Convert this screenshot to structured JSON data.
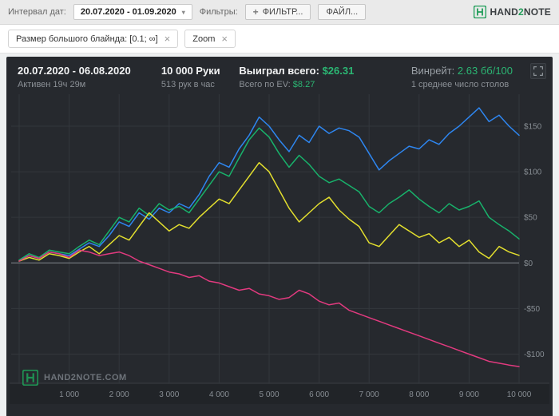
{
  "topbar": {
    "date_interval_label": "Интервал дат:",
    "date_range_value": "20.07.2020 - 01.09.2020",
    "filters_label": "Фильтры:",
    "filter_button": "ФИЛЬТР...",
    "file_button": "ФАЙЛ...",
    "brand_hand": "HAND",
    "brand_2": "2",
    "brand_note": "NOTE"
  },
  "icons": {
    "close": "×",
    "caret": "▾",
    "plus": "+"
  },
  "chips": [
    {
      "label": "Размер большого блайнда: [0.1; ∞]"
    },
    {
      "label": "Zoom"
    }
  ],
  "stats": {
    "date_range": "20.07.2020 - 06.08.2020",
    "active_time": "Активен 19ч 29м",
    "hands": "10 000 Руки",
    "hands_per_hour": "513 рук в час",
    "won_label": "Выиграл всего:",
    "won_value": "$26.31",
    "ev_label": "Всего по EV:",
    "ev_value": "$8.27",
    "winrate_label": "Винрейт:",
    "winrate_value": "2.63 бб/100",
    "tables_avg": "1 среднее число столов"
  },
  "watermark": "HAND2NOTE.COM",
  "chart_data": {
    "type": "line",
    "xlabel": "hands",
    "ylabel": "$ won",
    "xlim": [
      0,
      10000
    ],
    "ylim": [
      -132,
      178
    ],
    "x_step": 200,
    "grid": true,
    "x_ticks": [
      {
        "v": 1000,
        "label": "1 000"
      },
      {
        "v": 2000,
        "label": "2 000"
      },
      {
        "v": 3000,
        "label": "3 000"
      },
      {
        "v": 4000,
        "label": "4 000"
      },
      {
        "v": 5000,
        "label": "5 000"
      },
      {
        "v": 6000,
        "label": "6 000"
      },
      {
        "v": 7000,
        "label": "7 000"
      },
      {
        "v": 8000,
        "label": "8 000"
      },
      {
        "v": 9000,
        "label": "9 000"
      },
      {
        "v": 10000,
        "label": "10 000"
      }
    ],
    "y_ticks": [
      {
        "v": 150,
        "label": "$150"
      },
      {
        "v": 100,
        "label": "$100"
      },
      {
        "v": 50,
        "label": "$50"
      },
      {
        "v": 0,
        "label": "$0"
      },
      {
        "v": -50,
        "label": "-$50"
      },
      {
        "v": -100,
        "label": "-$100"
      }
    ],
    "series": [
      {
        "name": "blue-line",
        "color": "#2e86f0",
        "values": [
          3,
          8,
          5,
          12,
          10,
          8,
          15,
          22,
          18,
          30,
          45,
          40,
          55,
          48,
          60,
          55,
          65,
          60,
          75,
          95,
          110,
          105,
          125,
          140,
          160,
          150,
          135,
          122,
          140,
          132,
          150,
          142,
          148,
          145,
          138,
          120,
          102,
          112,
          120,
          128,
          125,
          135,
          130,
          142,
          150,
          160,
          170,
          155,
          162,
          150,
          140
        ]
      },
      {
        "name": "green-line",
        "color": "#18b26b",
        "values": [
          3,
          10,
          6,
          14,
          12,
          10,
          18,
          25,
          20,
          35,
          50,
          45,
          60,
          52,
          65,
          58,
          62,
          55,
          70,
          85,
          100,
          95,
          115,
          135,
          148,
          138,
          120,
          105,
          118,
          108,
          95,
          88,
          92,
          85,
          78,
          62,
          55,
          65,
          72,
          80,
          70,
          62,
          55,
          65,
          58,
          62,
          68,
          50,
          42,
          35,
          26.31
        ]
      },
      {
        "name": "yellow-line",
        "color": "#e3df2e",
        "values": [
          2,
          6,
          3,
          10,
          8,
          5,
          12,
          18,
          10,
          20,
          30,
          25,
          40,
          55,
          45,
          35,
          42,
          38,
          50,
          60,
          70,
          65,
          80,
          95,
          110,
          100,
          80,
          60,
          45,
          55,
          65,
          72,
          58,
          48,
          40,
          22,
          18,
          30,
          42,
          35,
          28,
          32,
          22,
          28,
          18,
          25,
          12,
          5,
          18,
          12,
          8.27
        ]
      },
      {
        "name": "pink-line",
        "color": "#e23a7f",
        "values": [
          2,
          8,
          5,
          12,
          10,
          6,
          14,
          12,
          8,
          10,
          12,
          8,
          2,
          -2,
          -6,
          -10,
          -12,
          -16,
          -14,
          -20,
          -22,
          -26,
          -30,
          -28,
          -34,
          -36,
          -40,
          -38,
          -30,
          -34,
          -42,
          -46,
          -44,
          -52,
          -56,
          -60,
          -64,
          -68,
          -72,
          -76,
          -80,
          -84,
          -88,
          -92,
          -96,
          -100,
          -104,
          -108,
          -110,
          -112,
          -113.7
        ]
      }
    ]
  }
}
